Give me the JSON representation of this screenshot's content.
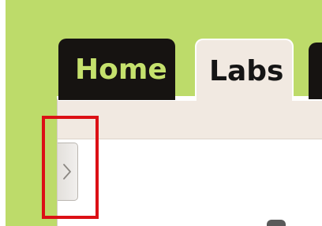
{
  "tabs": [
    {
      "label": "Home",
      "active": false
    },
    {
      "label": "Labs",
      "active": true
    }
  ],
  "sidebar_toggle": {
    "icon": "chevron-right-icon"
  },
  "colors": {
    "page_background": "#bddb6a",
    "inactive_tab": "#161311",
    "inactive_tab_text": "#c5e16d",
    "active_tab": "#f1e9e1",
    "active_tab_text": "#151515",
    "highlight": "#dc1015"
  }
}
